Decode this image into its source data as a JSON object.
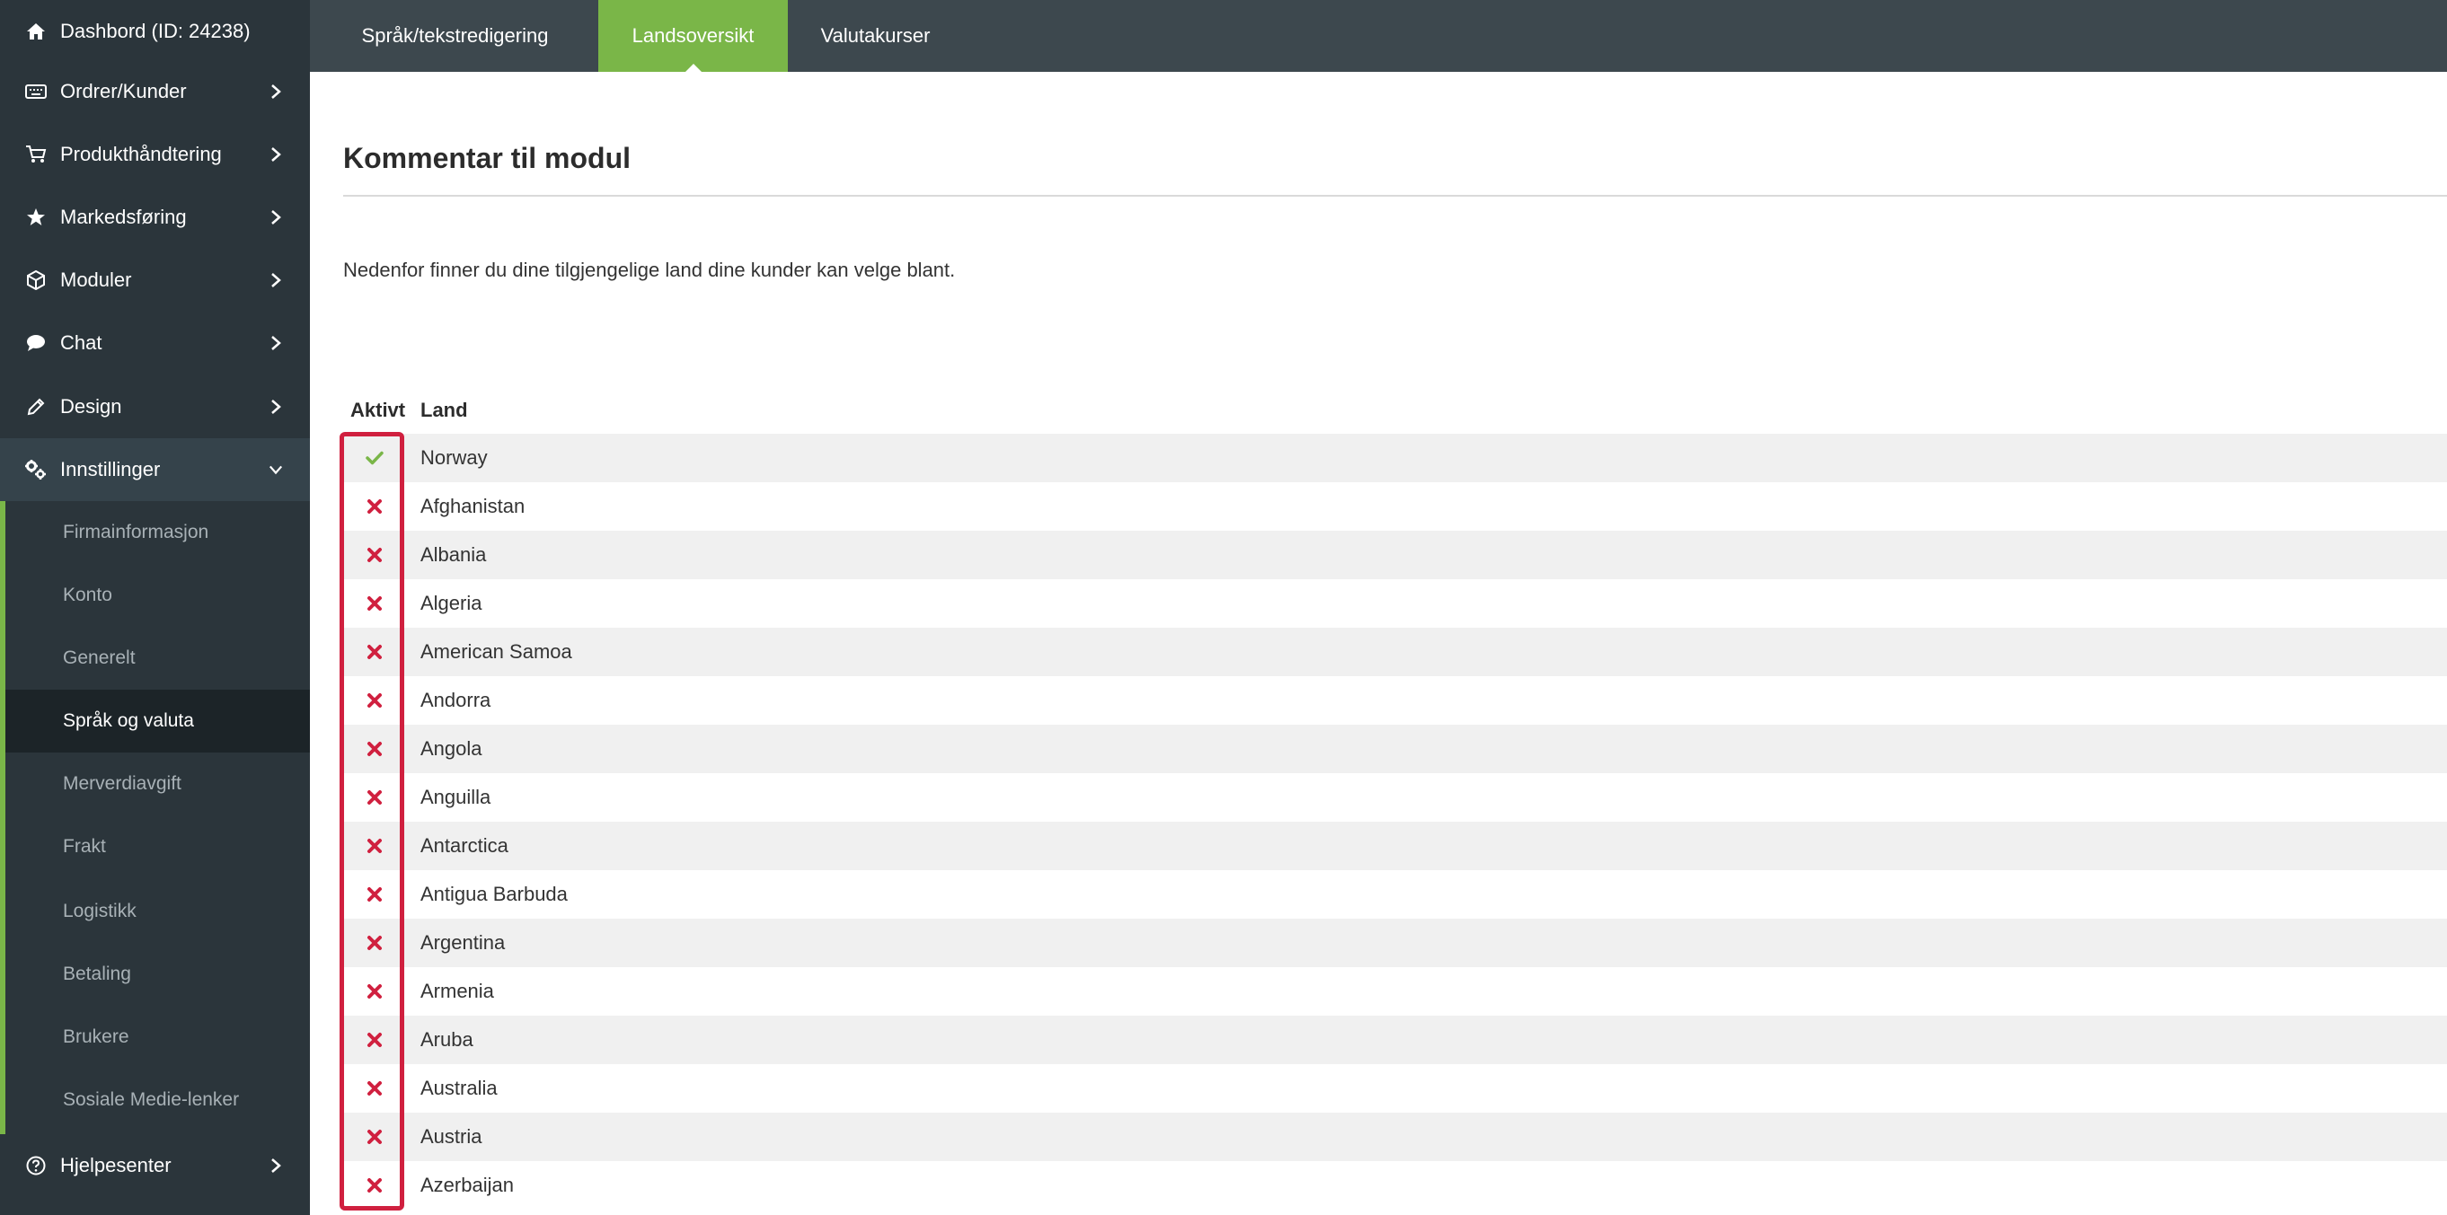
{
  "sidebar": {
    "items": [
      {
        "label": "Dashbord (ID: 24238)",
        "icon": "home-icon",
        "chevron": "none"
      },
      {
        "label": "Ordrer/Kunder",
        "icon": "keyboard-icon",
        "chevron": "right"
      },
      {
        "label": "Produkthåndtering",
        "icon": "cart-icon",
        "chevron": "right"
      },
      {
        "label": "Markedsføring",
        "icon": "star-icon",
        "chevron": "right"
      },
      {
        "label": "Moduler",
        "icon": "cube-icon",
        "chevron": "right"
      },
      {
        "label": "Chat",
        "icon": "chat-bubble-icon",
        "chevron": "right"
      },
      {
        "label": "Design",
        "icon": "pencil-icon",
        "chevron": "right"
      },
      {
        "label": "Innstillinger",
        "icon": "gears-icon",
        "chevron": "down"
      }
    ],
    "submenu": [
      "Firmainformasjon",
      "Konto",
      "Generelt",
      "Språk og valuta",
      "Merverdiavgift",
      "Frakt",
      "Logistikk",
      "Betaling",
      "Brukere",
      "Sosiale Medie-lenker"
    ],
    "submenu_active": "Språk og valuta",
    "help": {
      "label": "Hjelpesenter",
      "icon": "question-circle-icon"
    }
  },
  "tabs": [
    {
      "label": "Språk/tekstredigering",
      "active": false
    },
    {
      "label": "Landsoversikt",
      "active": true
    },
    {
      "label": "Valutakurser",
      "active": false
    }
  ],
  "main": {
    "heading": "Kommentar til modul",
    "description": "Nedenfor finner du dine tilgjengelige land dine kunder kan velge blant.",
    "table": {
      "headers": [
        "Aktivt",
        "Land"
      ],
      "rows": [
        {
          "active": true,
          "country": "Norway"
        },
        {
          "active": false,
          "country": "Afghanistan"
        },
        {
          "active": false,
          "country": "Albania"
        },
        {
          "active": false,
          "country": "Algeria"
        },
        {
          "active": false,
          "country": "American Samoa"
        },
        {
          "active": false,
          "country": "Andorra"
        },
        {
          "active": false,
          "country": "Angola"
        },
        {
          "active": false,
          "country": "Anguilla"
        },
        {
          "active": false,
          "country": "Antarctica"
        },
        {
          "active": false,
          "country": "Antigua Barbuda"
        },
        {
          "active": false,
          "country": "Argentina"
        },
        {
          "active": false,
          "country": "Armenia"
        },
        {
          "active": false,
          "country": "Aruba"
        },
        {
          "active": false,
          "country": "Australia"
        },
        {
          "active": false,
          "country": "Austria"
        },
        {
          "active": false,
          "country": "Azerbaijan"
        }
      ]
    }
  },
  "colors": {
    "sidebar_bg": "#2b353b",
    "topbar_bg": "#3d484e",
    "accent_green": "#7ab648",
    "check_green": "#7ab648",
    "cross_red": "#d0203f",
    "highlight_red": "#d0203f"
  }
}
